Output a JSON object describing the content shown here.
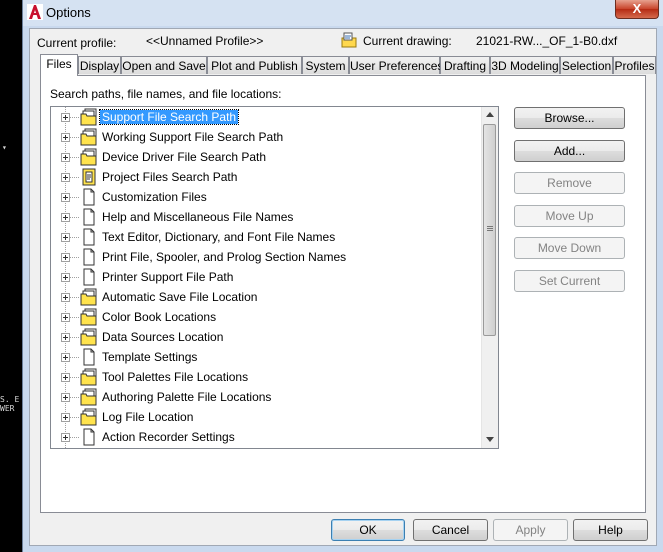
{
  "window": {
    "title": "Options",
    "close_label": "X"
  },
  "background_text": {
    "line1": "▾",
    "line2": "S. E",
    "line3": "WER"
  },
  "profile": {
    "label": "Current profile:",
    "value": "<<Unnamed Profile>>"
  },
  "drawing": {
    "label": "Current drawing:",
    "value": "21021-RW..._OF_1-B0.dxf"
  },
  "tabs": [
    {
      "label": "Files"
    },
    {
      "label": "Display"
    },
    {
      "label": "Open and Save"
    },
    {
      "label": "Plot and Publish"
    },
    {
      "label": "System"
    },
    {
      "label": "User Preferences"
    },
    {
      "label": "Drafting"
    },
    {
      "label": "3D Modeling"
    },
    {
      "label": "Selection"
    },
    {
      "label": "Profiles"
    }
  ],
  "files": {
    "heading": "Search paths, file names, and file locations:",
    "items": [
      {
        "label": "Support File Search Path",
        "icon": "folder-stack-icon"
      },
      {
        "label": "Working Support File Search Path",
        "icon": "folder-stack-icon"
      },
      {
        "label": "Device Driver File Search Path",
        "icon": "folder-stack-icon"
      },
      {
        "label": "Project Files Search Path",
        "icon": "project-file-icon"
      },
      {
        "label": "Customization Files",
        "icon": "file-icon"
      },
      {
        "label": "Help and Miscellaneous File Names",
        "icon": "file-icon"
      },
      {
        "label": "Text Editor, Dictionary, and Font File Names",
        "icon": "file-icon"
      },
      {
        "label": "Print File, Spooler, and Prolog Section Names",
        "icon": "file-icon"
      },
      {
        "label": "Printer Support File Path",
        "icon": "file-icon"
      },
      {
        "label": "Automatic Save File Location",
        "icon": "folder-stack-icon"
      },
      {
        "label": "Color Book Locations",
        "icon": "folder-stack-icon"
      },
      {
        "label": "Data Sources Location",
        "icon": "folder-stack-icon"
      },
      {
        "label": "Template Settings",
        "icon": "file-icon"
      },
      {
        "label": "Tool Palettes File Locations",
        "icon": "folder-stack-icon"
      },
      {
        "label": "Authoring Palette File Locations",
        "icon": "folder-stack-icon"
      },
      {
        "label": "Log File Location",
        "icon": "folder-stack-icon"
      },
      {
        "label": "Action Recorder Settings",
        "icon": "file-icon"
      }
    ]
  },
  "side_buttons": {
    "browse": "Browse...",
    "add": "Add...",
    "remove": "Remove",
    "move_up": "Move Up",
    "move_down": "Move Down",
    "set_current": "Set Current"
  },
  "footer": {
    "ok": "OK",
    "cancel": "Cancel",
    "apply": "Apply",
    "help": "Help"
  },
  "colors": {
    "selection": "#3399ff",
    "folder": "#ffe34d",
    "close": "#c8432a"
  }
}
